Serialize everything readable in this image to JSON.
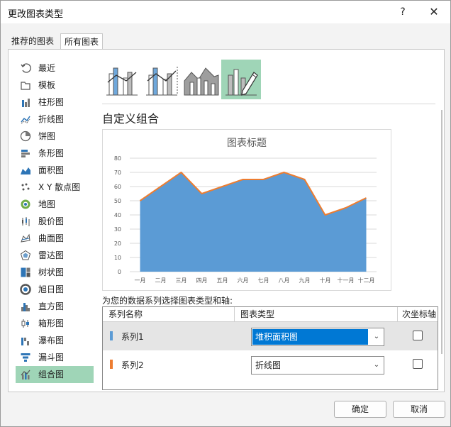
{
  "window": {
    "title": "更改图表类型",
    "help": "?",
    "close": "✕"
  },
  "tabs": [
    {
      "label": "推荐的图表"
    },
    {
      "label": "所有图表",
      "selected": true
    }
  ],
  "sidebar": {
    "items": [
      {
        "label": "最近",
        "icon": "recent-icon"
      },
      {
        "label": "模板",
        "icon": "template-icon"
      },
      {
        "label": "柱形图",
        "icon": "column-chart-icon"
      },
      {
        "label": "折线图",
        "icon": "line-chart-icon"
      },
      {
        "label": "饼图",
        "icon": "pie-chart-icon"
      },
      {
        "label": "条形图",
        "icon": "bar-chart-icon"
      },
      {
        "label": "面积图",
        "icon": "area-chart-icon"
      },
      {
        "label": "X Y 散点图",
        "icon": "scatter-chart-icon"
      },
      {
        "label": "地图",
        "icon": "map-chart-icon"
      },
      {
        "label": "股价图",
        "icon": "stock-chart-icon"
      },
      {
        "label": "曲面图",
        "icon": "surface-chart-icon"
      },
      {
        "label": "雷达图",
        "icon": "radar-chart-icon"
      },
      {
        "label": "树状图",
        "icon": "treemap-chart-icon"
      },
      {
        "label": "旭日图",
        "icon": "sunburst-chart-icon"
      },
      {
        "label": "直方图",
        "icon": "histogram-chart-icon"
      },
      {
        "label": "箱形图",
        "icon": "boxwhisker-chart-icon"
      },
      {
        "label": "瀑布图",
        "icon": "waterfall-chart-icon"
      },
      {
        "label": "漏斗图",
        "icon": "funnel-chart-icon"
      },
      {
        "label": "组合图",
        "icon": "combo-chart-icon",
        "selected": true
      }
    ]
  },
  "combo_types": [
    {
      "icon": "clustered-column-line-icon"
    },
    {
      "icon": "clustered-column-line-secondary-icon"
    },
    {
      "icon": "stacked-area-column-icon"
    },
    {
      "icon": "custom-combo-icon",
      "selected": true
    }
  ],
  "section_title": "自定义组合",
  "chart_data": {
    "type": "area",
    "title": "图表标题",
    "categories": [
      "一月",
      "二月",
      "三月",
      "四月",
      "五月",
      "六月",
      "七月",
      "八月",
      "九月",
      "十月",
      "十一月",
      "十二月"
    ],
    "series": [
      {
        "name": "系列1",
        "chart_type": "area",
        "color": "#5b9bd5",
        "values": [
          50,
          60,
          70,
          55,
          60,
          65,
          65,
          70,
          65,
          40,
          45,
          52
        ]
      },
      {
        "name": "系列2",
        "chart_type": "line",
        "color": "#ed7d31",
        "values": [
          50,
          60,
          70,
          55,
          60,
          65,
          65,
          70,
          65,
          40,
          45,
          52
        ]
      }
    ],
    "y_ticks": [
      "0",
      "10",
      "20",
      "30",
      "40",
      "50",
      "60",
      "70",
      "80"
    ],
    "ylim": [
      0,
      80
    ],
    "grid": true,
    "legend": "none"
  },
  "assign_label": "为您的数据系列选择图表类型和轴:",
  "series_table": {
    "headers": {
      "name": "系列名称",
      "type": "图表类型",
      "secondary": "次坐标轴"
    },
    "rows": [
      {
        "name": "系列1",
        "type": "堆积面积图",
        "color": "#5b9bd5",
        "secondary": false
      },
      {
        "name": "系列2",
        "type": "折线图",
        "color": "#ed7d31",
        "secondary": false
      }
    ]
  },
  "buttons": {
    "ok": "确定",
    "cancel": "取消"
  }
}
